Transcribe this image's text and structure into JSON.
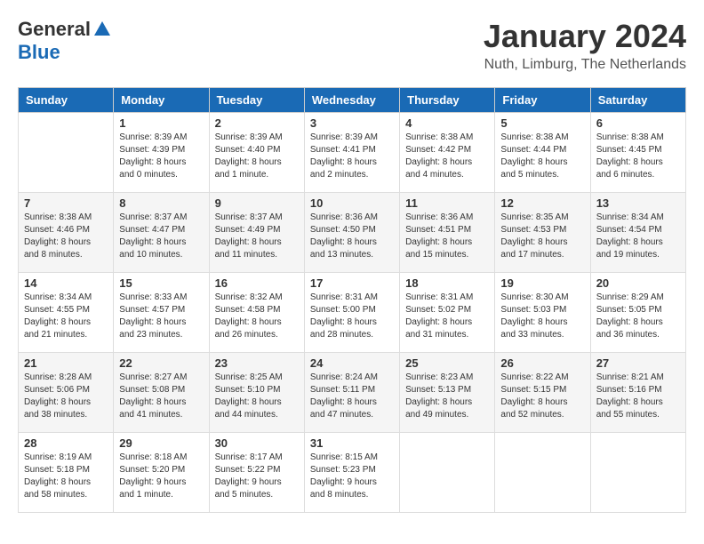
{
  "header": {
    "logo": {
      "general": "General",
      "blue": "Blue"
    },
    "title": "January 2024",
    "location": "Nuth, Limburg, The Netherlands"
  },
  "weekdays": [
    "Sunday",
    "Monday",
    "Tuesday",
    "Wednesday",
    "Thursday",
    "Friday",
    "Saturday"
  ],
  "weeks": [
    [
      {
        "day": "",
        "sunrise": "",
        "sunset": "",
        "daylight": ""
      },
      {
        "day": "1",
        "sunrise": "Sunrise: 8:39 AM",
        "sunset": "Sunset: 4:39 PM",
        "daylight": "Daylight: 8 hours and 0 minutes."
      },
      {
        "day": "2",
        "sunrise": "Sunrise: 8:39 AM",
        "sunset": "Sunset: 4:40 PM",
        "daylight": "Daylight: 8 hours and 1 minute."
      },
      {
        "day": "3",
        "sunrise": "Sunrise: 8:39 AM",
        "sunset": "Sunset: 4:41 PM",
        "daylight": "Daylight: 8 hours and 2 minutes."
      },
      {
        "day": "4",
        "sunrise": "Sunrise: 8:38 AM",
        "sunset": "Sunset: 4:42 PM",
        "daylight": "Daylight: 8 hours and 4 minutes."
      },
      {
        "day": "5",
        "sunrise": "Sunrise: 8:38 AM",
        "sunset": "Sunset: 4:44 PM",
        "daylight": "Daylight: 8 hours and 5 minutes."
      },
      {
        "day": "6",
        "sunrise": "Sunrise: 8:38 AM",
        "sunset": "Sunset: 4:45 PM",
        "daylight": "Daylight: 8 hours and 6 minutes."
      }
    ],
    [
      {
        "day": "7",
        "sunrise": "Sunrise: 8:38 AM",
        "sunset": "Sunset: 4:46 PM",
        "daylight": "Daylight: 8 hours and 8 minutes."
      },
      {
        "day": "8",
        "sunrise": "Sunrise: 8:37 AM",
        "sunset": "Sunset: 4:47 PM",
        "daylight": "Daylight: 8 hours and 10 minutes."
      },
      {
        "day": "9",
        "sunrise": "Sunrise: 8:37 AM",
        "sunset": "Sunset: 4:49 PM",
        "daylight": "Daylight: 8 hours and 11 minutes."
      },
      {
        "day": "10",
        "sunrise": "Sunrise: 8:36 AM",
        "sunset": "Sunset: 4:50 PM",
        "daylight": "Daylight: 8 hours and 13 minutes."
      },
      {
        "day": "11",
        "sunrise": "Sunrise: 8:36 AM",
        "sunset": "Sunset: 4:51 PM",
        "daylight": "Daylight: 8 hours and 15 minutes."
      },
      {
        "day": "12",
        "sunrise": "Sunrise: 8:35 AM",
        "sunset": "Sunset: 4:53 PM",
        "daylight": "Daylight: 8 hours and 17 minutes."
      },
      {
        "day": "13",
        "sunrise": "Sunrise: 8:34 AM",
        "sunset": "Sunset: 4:54 PM",
        "daylight": "Daylight: 8 hours and 19 minutes."
      }
    ],
    [
      {
        "day": "14",
        "sunrise": "Sunrise: 8:34 AM",
        "sunset": "Sunset: 4:55 PM",
        "daylight": "Daylight: 8 hours and 21 minutes."
      },
      {
        "day": "15",
        "sunrise": "Sunrise: 8:33 AM",
        "sunset": "Sunset: 4:57 PM",
        "daylight": "Daylight: 8 hours and 23 minutes."
      },
      {
        "day": "16",
        "sunrise": "Sunrise: 8:32 AM",
        "sunset": "Sunset: 4:58 PM",
        "daylight": "Daylight: 8 hours and 26 minutes."
      },
      {
        "day": "17",
        "sunrise": "Sunrise: 8:31 AM",
        "sunset": "Sunset: 5:00 PM",
        "daylight": "Daylight: 8 hours and 28 minutes."
      },
      {
        "day": "18",
        "sunrise": "Sunrise: 8:31 AM",
        "sunset": "Sunset: 5:02 PM",
        "daylight": "Daylight: 8 hours and 31 minutes."
      },
      {
        "day": "19",
        "sunrise": "Sunrise: 8:30 AM",
        "sunset": "Sunset: 5:03 PM",
        "daylight": "Daylight: 8 hours and 33 minutes."
      },
      {
        "day": "20",
        "sunrise": "Sunrise: 8:29 AM",
        "sunset": "Sunset: 5:05 PM",
        "daylight": "Daylight: 8 hours and 36 minutes."
      }
    ],
    [
      {
        "day": "21",
        "sunrise": "Sunrise: 8:28 AM",
        "sunset": "Sunset: 5:06 PM",
        "daylight": "Daylight: 8 hours and 38 minutes."
      },
      {
        "day": "22",
        "sunrise": "Sunrise: 8:27 AM",
        "sunset": "Sunset: 5:08 PM",
        "daylight": "Daylight: 8 hours and 41 minutes."
      },
      {
        "day": "23",
        "sunrise": "Sunrise: 8:25 AM",
        "sunset": "Sunset: 5:10 PM",
        "daylight": "Daylight: 8 hours and 44 minutes."
      },
      {
        "day": "24",
        "sunrise": "Sunrise: 8:24 AM",
        "sunset": "Sunset: 5:11 PM",
        "daylight": "Daylight: 8 hours and 47 minutes."
      },
      {
        "day": "25",
        "sunrise": "Sunrise: 8:23 AM",
        "sunset": "Sunset: 5:13 PM",
        "daylight": "Daylight: 8 hours and 49 minutes."
      },
      {
        "day": "26",
        "sunrise": "Sunrise: 8:22 AM",
        "sunset": "Sunset: 5:15 PM",
        "daylight": "Daylight: 8 hours and 52 minutes."
      },
      {
        "day": "27",
        "sunrise": "Sunrise: 8:21 AM",
        "sunset": "Sunset: 5:16 PM",
        "daylight": "Daylight: 8 hours and 55 minutes."
      }
    ],
    [
      {
        "day": "28",
        "sunrise": "Sunrise: 8:19 AM",
        "sunset": "Sunset: 5:18 PM",
        "daylight": "Daylight: 8 hours and 58 minutes."
      },
      {
        "day": "29",
        "sunrise": "Sunrise: 8:18 AM",
        "sunset": "Sunset: 5:20 PM",
        "daylight": "Daylight: 9 hours and 1 minute."
      },
      {
        "day": "30",
        "sunrise": "Sunrise: 8:17 AM",
        "sunset": "Sunset: 5:22 PM",
        "daylight": "Daylight: 9 hours and 5 minutes."
      },
      {
        "day": "31",
        "sunrise": "Sunrise: 8:15 AM",
        "sunset": "Sunset: 5:23 PM",
        "daylight": "Daylight: 9 hours and 8 minutes."
      },
      {
        "day": "",
        "sunrise": "",
        "sunset": "",
        "daylight": ""
      },
      {
        "day": "",
        "sunrise": "",
        "sunset": "",
        "daylight": ""
      },
      {
        "day": "",
        "sunrise": "",
        "sunset": "",
        "daylight": ""
      }
    ]
  ]
}
